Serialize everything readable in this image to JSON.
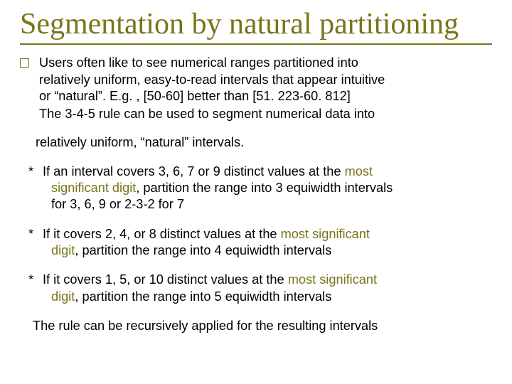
{
  "title": "Segmentation by natural partitioning",
  "body": {
    "intro_l1": "Users often like to see numerical ranges partitioned into",
    "intro_l2": "relatively uniform, easy-to-read intervals that appear intuitive",
    "intro_l3": "or “natural”. E.g. , [50-60] better than [51. 223-60. 812]",
    "rule_lead": "The 3-4-5 rule can be used to segment numerical data into",
    "rule_tail": "relatively uniform, “natural” intervals.",
    "r1_a": "If an interval covers 3, 6, 7 or 9 distinct values at the ",
    "r1_accent1": "most",
    "r1_b_indent_accent": "significant digit",
    "r1_b_rest": ", partition the range into 3 equiwidth intervals",
    "r1_c": "for 3, 6, 9 or 2-3-2 for 7",
    "r2_a": "If it covers 2, 4, or 8 distinct values at the ",
    "r2_accent": "most significant",
    "r2_b_accent": "digit",
    "r2_b_rest": ", partition the range into 4 equiwidth intervals",
    "r3_a": "If it covers 1, 5, or 10 distinct values at the ",
    "r3_accent": "most significant",
    "r3_b_accent": "digit",
    "r3_b_rest": ", partition the range into 5 equiwidth intervals",
    "conclude": "The rule can be recursively applied for the resulting intervals"
  }
}
